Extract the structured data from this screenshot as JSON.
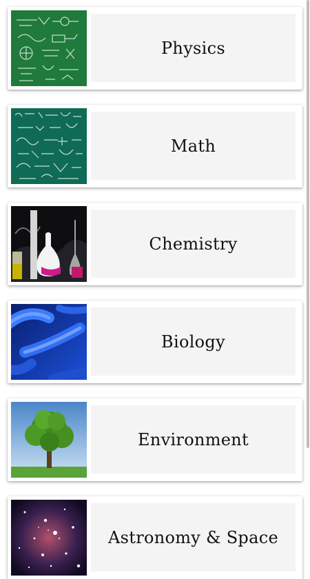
{
  "categories": [
    {
      "label": "Physics",
      "image": "physics-chalkboard-image"
    },
    {
      "label": "Math",
      "image": "math-chalkboard-image"
    },
    {
      "label": "Chemistry",
      "image": "chemistry-flasks-image"
    },
    {
      "label": "Biology",
      "image": "bacteria-image"
    },
    {
      "label": "Environment",
      "image": "tree-image"
    },
    {
      "label": "Astronomy & Space",
      "image": "star-cluster-image"
    }
  ],
  "colors": {
    "physics_board": "#1f7a3c",
    "math_board": "#0f6b55",
    "biology_bg": "#0b2a8c",
    "sky": "#6fa6d8",
    "grass": "#5aa33a",
    "space": "#1a1030"
  }
}
